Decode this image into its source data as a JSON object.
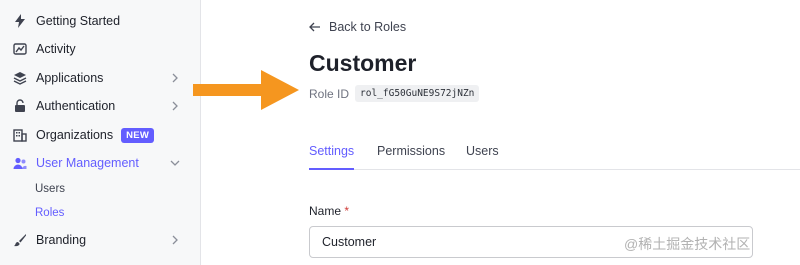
{
  "sidebar": {
    "items": [
      {
        "label": "Getting Started",
        "icon": "lightning-icon"
      },
      {
        "label": "Activity",
        "icon": "chart-icon"
      },
      {
        "label": "Applications",
        "icon": "layers-icon"
      },
      {
        "label": "Authentication",
        "icon": "lock-icon"
      },
      {
        "label": "Organizations",
        "icon": "building-icon",
        "badge": "NEW"
      },
      {
        "label": "User Management",
        "icon": "users-icon"
      },
      {
        "label": "Branding",
        "icon": "brush-icon"
      }
    ],
    "subitems": [
      {
        "label": "Users"
      },
      {
        "label": "Roles"
      }
    ]
  },
  "main": {
    "back_label": "Back to Roles",
    "title": "Customer",
    "role_id_label": "Role ID",
    "role_id_value": "rol_fG50GuNE9S72jNZn",
    "tabs": [
      {
        "label": "Settings"
      },
      {
        "label": "Permissions"
      },
      {
        "label": "Users"
      }
    ],
    "name_label": "Name",
    "required_mark": "*",
    "name_value": "Customer"
  },
  "watermark": "@稀土掘金技术社区",
  "colors": {
    "accent": "#635dff",
    "arrow": "#f5961f",
    "required": "#d03c38"
  }
}
